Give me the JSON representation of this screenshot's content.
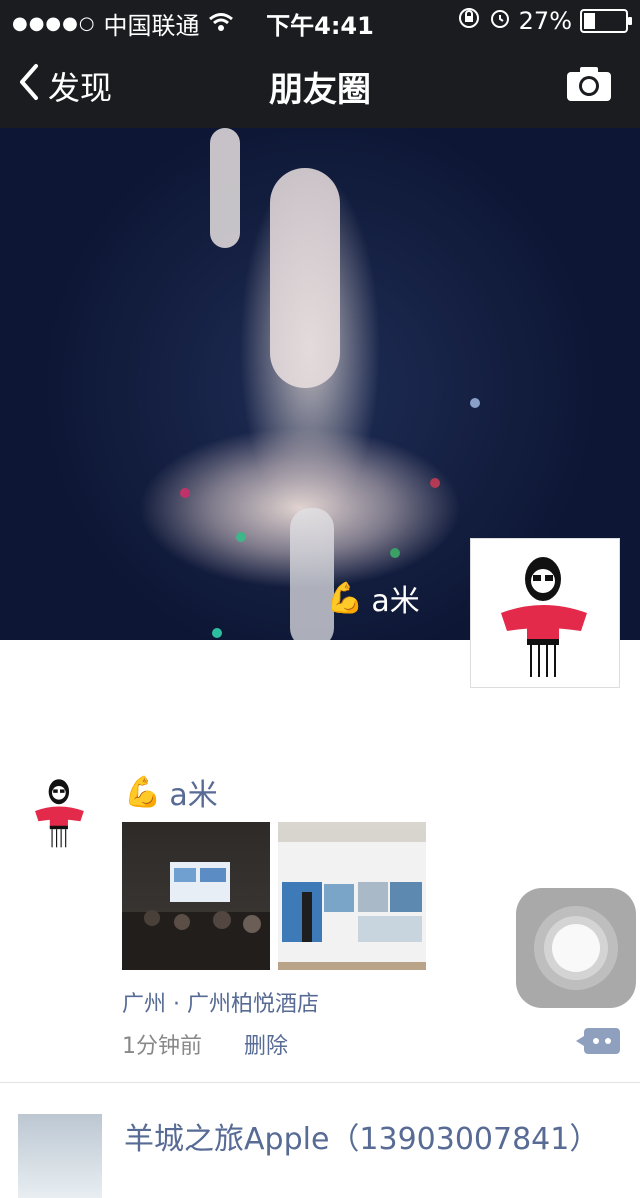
{
  "status_bar": {
    "signal_dots": "●●●●○",
    "carrier": "中国联通",
    "time": "下午4:41",
    "battery_percent": "27%",
    "battery_level": 0.27
  },
  "nav": {
    "back_label": "发现",
    "title": "朋友圈"
  },
  "cover": {
    "user_emoji": "💪",
    "username": "a米"
  },
  "post": {
    "emoji": "💪",
    "author": "a米",
    "location": "广州 · 广州柏悦酒店",
    "time_ago": "1分钟前",
    "delete_label": "删除"
  },
  "next_post": {
    "author": "羊城之旅Apple（13903007841）"
  },
  "colors": {
    "link_blue": "#576b95",
    "bar_dark": "#1b1c20"
  }
}
